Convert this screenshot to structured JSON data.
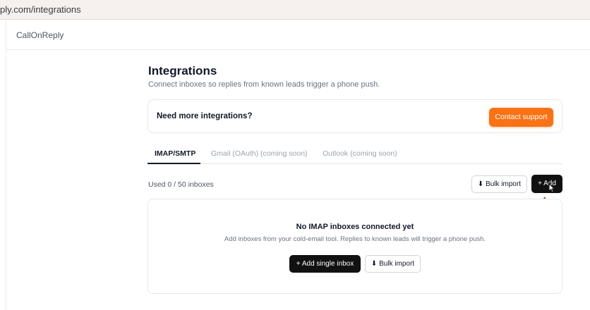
{
  "browser": {
    "url": "ply.com/integrations"
  },
  "header": {
    "brand": "CallOnReply"
  },
  "page": {
    "title": "Integrations",
    "subtitle": "Connect inboxes so replies from known leads trigger a phone push."
  },
  "promo": {
    "text": "Need more integrations?",
    "button": "Contact support"
  },
  "tabs": [
    {
      "label": "IMAP/SMTP",
      "active": true
    },
    {
      "label": "Gmail (OAuth) (coming soon)",
      "active": false
    },
    {
      "label": "Outlook (coming soon)",
      "active": false
    }
  ],
  "toolbar": {
    "usage": "Used 0 / 50 inboxes",
    "bulk_import": "⬇ Bulk import",
    "add": "+ Add"
  },
  "empty_state": {
    "title": "No IMAP inboxes connected yet",
    "subtitle": "Add inboxes from your cold-email tool. Replies to known leads will trigger a phone push.",
    "add_single": "+ Add single inbox",
    "bulk_import": "⬇ Bulk import"
  },
  "colors": {
    "accent": "#f97316",
    "primary": "#111111",
    "annotation_arrow": "#e11d1d"
  }
}
